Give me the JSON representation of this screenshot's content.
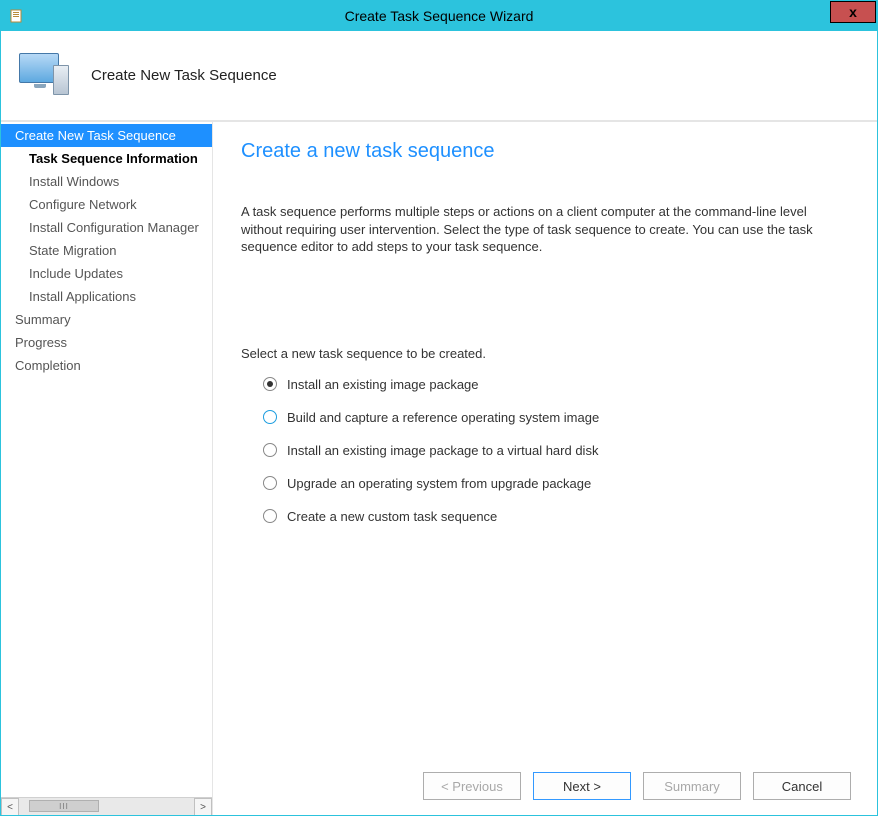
{
  "window": {
    "title": "Create Task Sequence Wizard"
  },
  "header": {
    "title": "Create New Task Sequence"
  },
  "sidebar": {
    "items": [
      {
        "label": "Create New Task Sequence",
        "level": "toplevel",
        "state": "selected"
      },
      {
        "label": "Task Sequence Information",
        "level": "sub",
        "state": "bold"
      },
      {
        "label": "Install Windows",
        "level": "sub",
        "state": ""
      },
      {
        "label": "Configure Network",
        "level": "sub",
        "state": ""
      },
      {
        "label": "Install Configuration Manager",
        "level": "sub",
        "state": ""
      },
      {
        "label": "State Migration",
        "level": "sub",
        "state": ""
      },
      {
        "label": "Include Updates",
        "level": "sub",
        "state": ""
      },
      {
        "label": "Install Applications",
        "level": "sub",
        "state": ""
      },
      {
        "label": "Summary",
        "level": "toplevel",
        "state": ""
      },
      {
        "label": "Progress",
        "level": "toplevel",
        "state": ""
      },
      {
        "label": "Completion",
        "level": "toplevel",
        "state": ""
      }
    ],
    "thumbLabel": "III"
  },
  "main": {
    "title": "Create a new task sequence",
    "description": "A task sequence performs multiple steps or actions on a client computer at the command-line level without requiring user intervention. Select the type of task sequence to create. You can use the task sequence editor to add steps to your task sequence.",
    "selectLabel": "Select a new task sequence to be created.",
    "options": [
      {
        "label": "Install an existing image package",
        "checked": true,
        "hover": false
      },
      {
        "label": "Build and capture a reference operating system image",
        "checked": false,
        "hover": true
      },
      {
        "label": "Install an existing image package to a virtual hard disk",
        "checked": false,
        "hover": false
      },
      {
        "label": "Upgrade an operating system from upgrade package",
        "checked": false,
        "hover": false
      },
      {
        "label": "Create a new custom task sequence",
        "checked": false,
        "hover": false
      }
    ]
  },
  "footer": {
    "previous": "< Previous",
    "next": "Next >",
    "summary": "Summary",
    "cancel": "Cancel"
  }
}
